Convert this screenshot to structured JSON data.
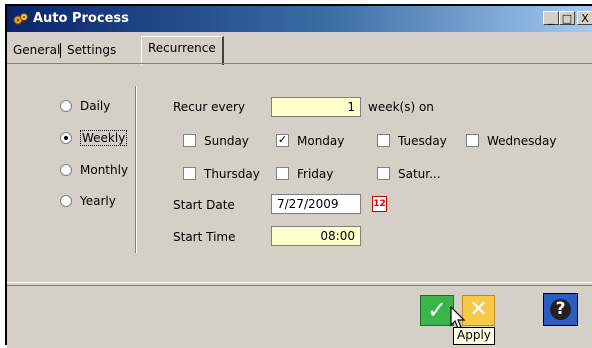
{
  "window": {
    "title": "Auto Process",
    "controls": {
      "minimize": "_",
      "maximize": "□",
      "close": "X"
    }
  },
  "tabs": [
    {
      "label": "General",
      "active": false
    },
    {
      "label": "Settings",
      "active": false
    },
    {
      "label": "Recurrence",
      "active": true
    }
  ],
  "frequency": {
    "options": [
      "Daily",
      "Weekly",
      "Monthly",
      "Yearly"
    ],
    "selected": "Weekly"
  },
  "recurrence": {
    "recur_every_label": "Recur every",
    "recur_every_value": "1",
    "recur_every_suffix": "week(s) on",
    "days": [
      {
        "label": "Sunday",
        "checked": false
      },
      {
        "label": "Monday",
        "checked": true
      },
      {
        "label": "Tuesday",
        "checked": false
      },
      {
        "label": "Wednesday",
        "checked": false
      },
      {
        "label": "Thursday",
        "checked": false
      },
      {
        "label": "Friday",
        "checked": false
      },
      {
        "label": "Satur...",
        "checked": false
      }
    ],
    "start_date_label": "Start Date",
    "start_date_value": "7/27/2009",
    "calendar_icon_text": "12",
    "start_time_label": "Start Time",
    "start_time_value": "08:00"
  },
  "footer": {
    "ok_glyph": "✓",
    "cancel_glyph": "✕",
    "help_glyph": "?",
    "tooltip": "Apply"
  },
  "icons": {
    "app": "gears-icon",
    "ok": "checkmark-icon",
    "cancel": "x-icon",
    "help": "question-icon",
    "calendar": "calendar-icon",
    "cursor": "mouse-pointer-icon"
  },
  "colors": {
    "titlebar_start": "#0a246a",
    "titlebar_end": "#a6caf0",
    "field_bg": "#ffffcc",
    "ok": "#3bb54a",
    "cancel": "#f7c948",
    "help": "#2b5cc4"
  }
}
